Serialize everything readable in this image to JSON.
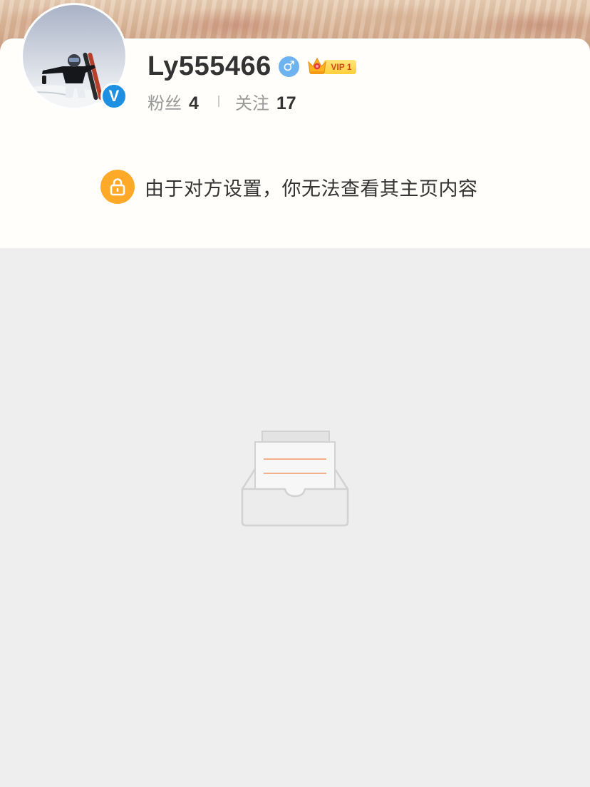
{
  "profile": {
    "username": "Ly555466",
    "gender_icon": "male-symbol-icon",
    "gender_glyph": "♂",
    "verified_icon": "verified-v-icon",
    "verified_glyph": "V",
    "vip": {
      "icon": "crown-icon",
      "label": "VIP 1"
    },
    "stats": {
      "fans_label": "粉丝",
      "fans_count": "4",
      "following_label": "关注",
      "following_count": "17"
    }
  },
  "privacy_notice": {
    "icon": "lock-icon",
    "text": "由于对方设置，你无法查看其主页内容"
  },
  "empty_state": {
    "icon": "empty-inbox-icon"
  },
  "colors": {
    "verified_blue": "#1e8fe1",
    "gender_blue": "#6db3ef",
    "lock_orange": "#ffa928",
    "vip_gold": "#ffcf3a",
    "vip_text_red": "#d14a1e",
    "page_gray": "#eeeeee"
  }
}
